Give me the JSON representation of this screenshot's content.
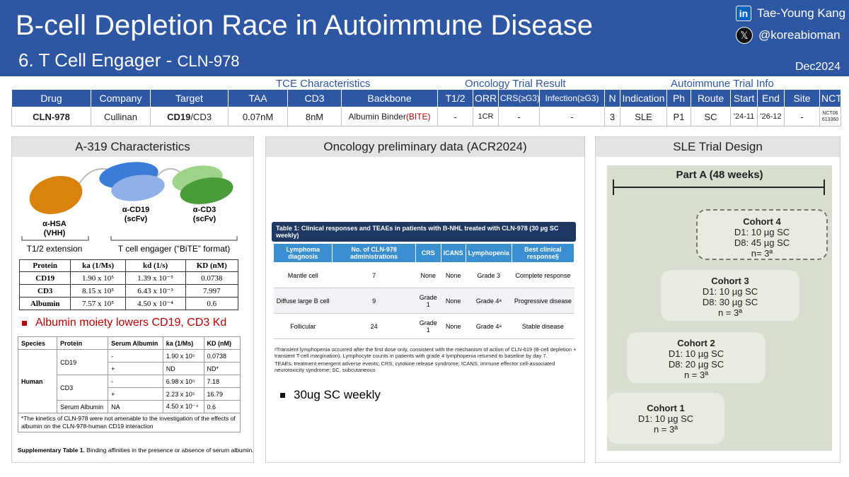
{
  "header": {
    "title": "B-cell Depletion Race in Autoimmune Disease",
    "subtitle_main": "6. T Cell Engager - ",
    "subtitle_drug": "CLN-978",
    "author": "Tae-Young Kang",
    "handle": "@koreabioman",
    "date": "Dec2024",
    "linkedin_icon": "linkedin-icon",
    "x_icon": "x-logo-icon"
  },
  "categories": {
    "tce": "TCE Characteristics",
    "onc": "Oncology Trial Result",
    "auto": "Autoimmune Trial Info"
  },
  "table": {
    "headers": [
      "Drug",
      "Company",
      "Target",
      "TAA",
      "CD3",
      "Backbone",
      "T1/2",
      "ORR",
      "CRS(≥G3)",
      "Infection(≥G3)",
      "N",
      "Indication",
      "Ph",
      "Route",
      "Start",
      "End",
      "Site",
      "NCT"
    ],
    "row": {
      "drug": "CLN-978",
      "company": "Cullinan",
      "target_bold": "CD19",
      "target_rest": "/CD3",
      "taa": "0.07nM",
      "cd3": "8nM",
      "backbone": "Albumin Binder",
      "backbone_red": "(BITE)",
      "t12": "-",
      "orr": "1CR",
      "crs": "-",
      "infection": "-",
      "n": "3",
      "indication": "SLE",
      "ph": "P1",
      "route": "SC",
      "start": "'24-11",
      "end": "'26-12",
      "site": "-",
      "nct": "NCT06613360"
    }
  },
  "panel1": {
    "title": "A-319 Characteristics",
    "diagram": {
      "d1": "α-HSA",
      "d1b": "(VHH)",
      "d2": "α-CD19",
      "d2b": "(scFv)",
      "d3": "α-CD3",
      "d3b": "(scFv)",
      "ext": "T1/2 extension",
      "eng": "T cell engager (“BiTE” format)"
    },
    "kinetics": {
      "headers": [
        "Protein",
        "ka (1/Ms)",
        "kd (1/s)",
        "KD (nM)"
      ],
      "rows": [
        [
          "CD19",
          "1.90 x 10⁵",
          "1.39 x 10⁻⁵",
          "0.0738"
        ],
        [
          "CD3",
          "8.15 x 10⁵",
          "6.43 x 10⁻³",
          "7.997"
        ],
        [
          "Albumin",
          "7.57 x 10⁵",
          "4.50 x 10⁻⁴",
          "0.6"
        ]
      ]
    },
    "bullet": "Albumin moiety lowers CD19, CD3 Kd",
    "supp": {
      "headers": [
        "Species",
        "Protein",
        "Serum Albumin",
        "ka (1/Ms)",
        "KD (nM)"
      ],
      "human": "Human",
      "cd19": "CD19",
      "cd3": "CD3",
      "serum": "Serum Albumin",
      "r1": [
        "-",
        "1.90 x 10⁵",
        "0.0738"
      ],
      "r2": [
        "+",
        "ND",
        "ND*"
      ],
      "r3": [
        "-",
        "6.98 x 10⁵",
        "7.18"
      ],
      "r4": [
        "+",
        "2.23 x 10⁵",
        "16.79"
      ],
      "r5": [
        "NA",
        "4.50 x 10⁻⁴",
        "0.6"
      ],
      "note": "*The kinetics of CLN-978 were not amenable to the investigation of the effects of albumin on the CLN-978-human CD19 interaction",
      "caption_bold": "Supplementary Table 1.",
      "caption": " Binding affinities in the presence or absence of serum albumin."
    }
  },
  "panel2": {
    "title": "Oncology preliminary data (ACR2024)",
    "table_title": "Table 1: Clinical responses and TEAEs in patients with B-NHL treated with CLN-978 (30 µg SC weekly)",
    "headers": [
      "Lymphoma diagnosis",
      "No. of CLN-978 administrations",
      "CRS",
      "ICANS",
      "Lymphopenia",
      "Best clinical response§"
    ],
    "rows": [
      [
        "Mantle cell",
        "7",
        "None",
        "None",
        "Grade 3",
        "Complete response"
      ],
      [
        "Diffuse large B cell",
        "9",
        "Grade 1",
        "None",
        "Grade 4ᵃ",
        "Progressive disease"
      ],
      [
        "Follicular",
        "24",
        "Grade 1",
        "None",
        "Grade 4ᵃ",
        "Stable disease"
      ]
    ],
    "footnote": "ᵃTransient lymphopenia occurred after the first dose only, consistent with the mechanism of action of CLN-619 (B-cell depletion + transient T-cell margination). Lymphocyte counts in patients with grade 4 lymphopenia returned to baseline by day 7.",
    "abbrev": "TEAEs, treatment-emergent adverse events; CRS, cytokine release syndrome; ICANS, immune effector cell-associated neurotoxicity syndrome; SC, subcutaneous",
    "bullet": "30ug SC weekly"
  },
  "panel3": {
    "title": "SLE Trial Design",
    "part": "Part A (48 weeks)",
    "c4": {
      "name": "Cohort 4",
      "l1": "D1: 10 µg SC",
      "l2": "D8: 45 µg SC",
      "l3": "n= 3ª"
    },
    "c3": {
      "name": "Cohort 3",
      "l1": "D1: 10 µg SC",
      "l2": "D8: 30 µg SC",
      "l3": "n = 3ª"
    },
    "c2": {
      "name": "Cohort 2",
      "l1": "D1: 10 µg SC",
      "l2": "D8: 20 µg SC",
      "l3": "n = 3ª"
    },
    "c1": {
      "name": "Cohort 1",
      "l1": "D1: 10 µg SC",
      "l2": "n = 3ª"
    }
  },
  "colors": {
    "blue": "#2e57a3",
    "red": "#c00000",
    "table_blue": "#3a8fd0"
  }
}
